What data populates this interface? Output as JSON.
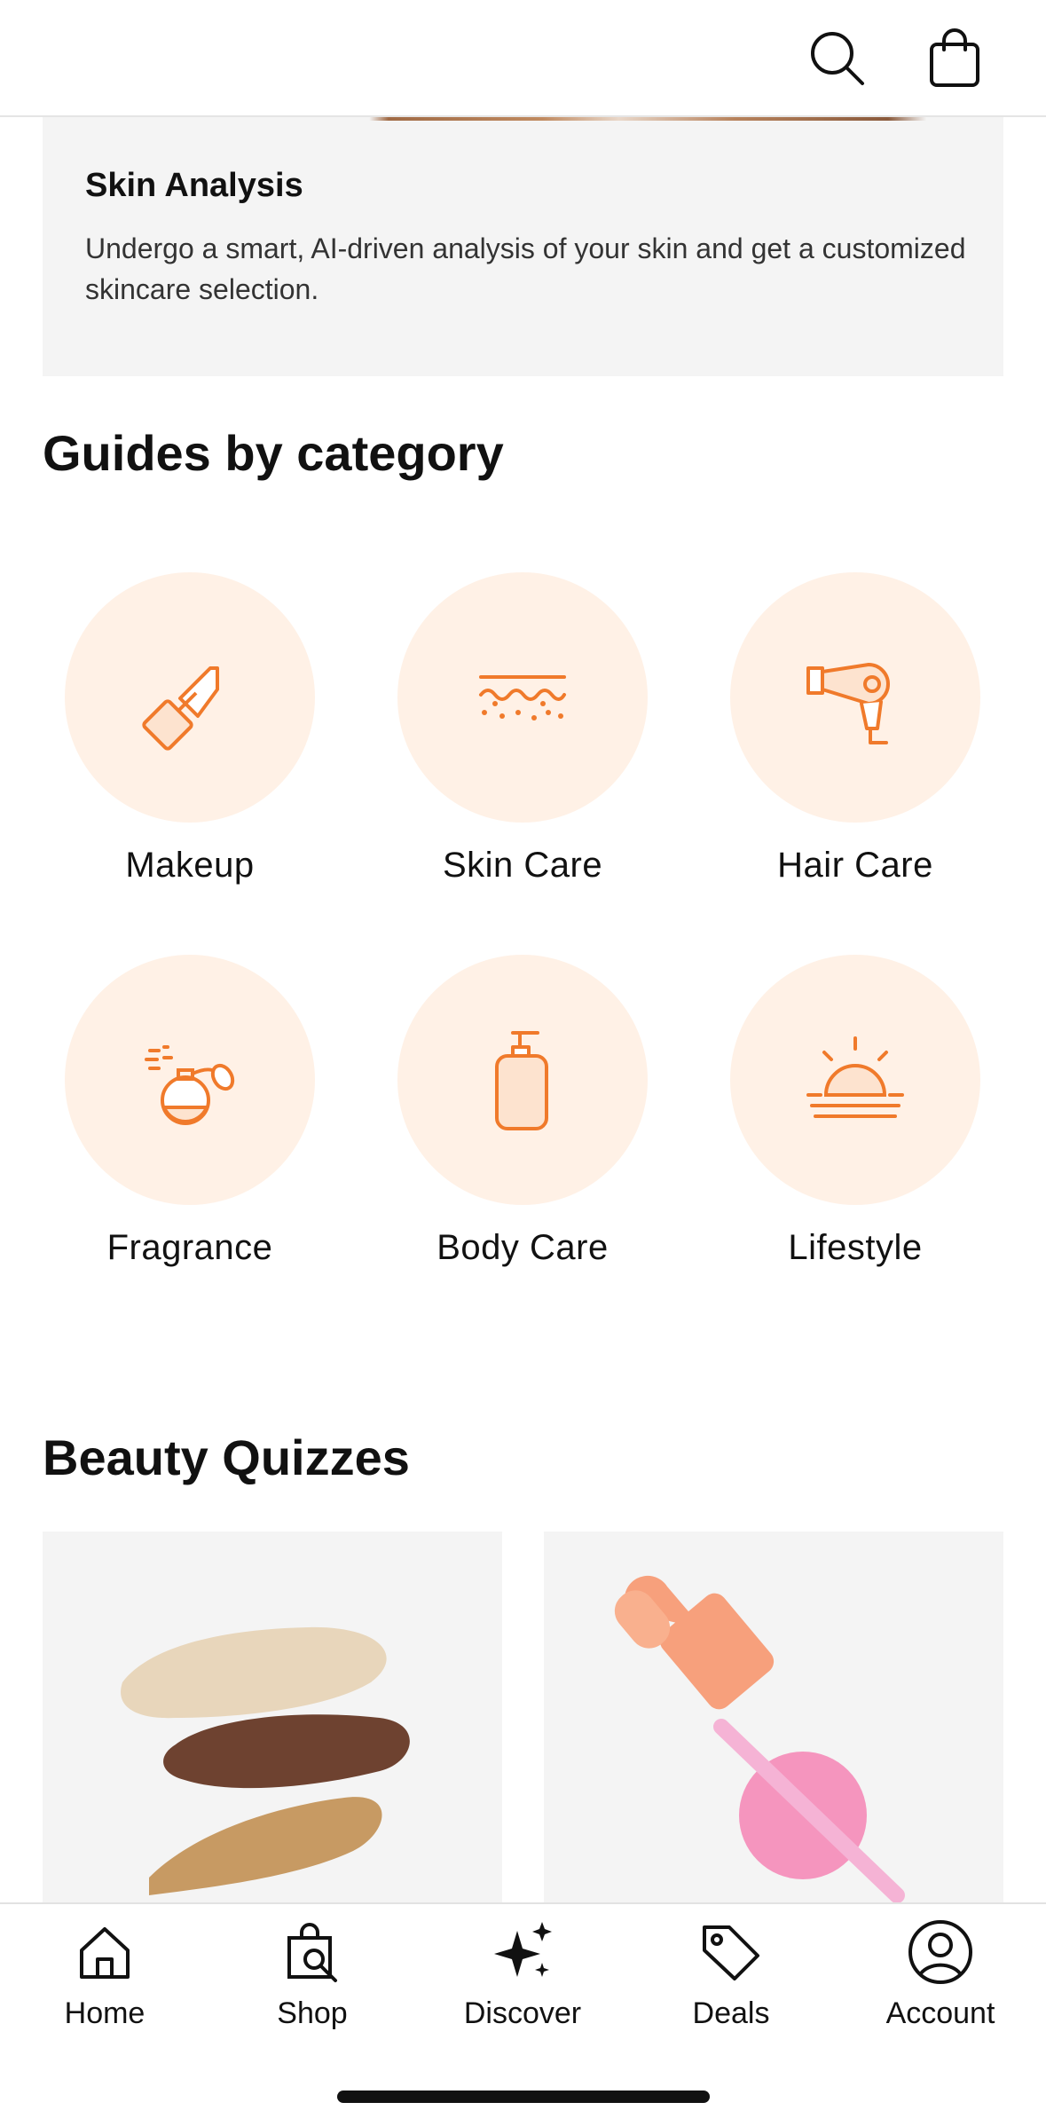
{
  "header": {
    "search_icon": "search-icon",
    "bag_icon": "shopping-bag-icon"
  },
  "skin_analysis": {
    "title": "Skin Analysis",
    "description": "Undergo a smart, AI-driven analysis of your skin and get a customized skincare selection."
  },
  "guides": {
    "title": "Guides by category",
    "categories": [
      {
        "label": "Makeup",
        "icon": "lipstick-icon"
      },
      {
        "label": "Skin Care",
        "icon": "skin-layers-icon"
      },
      {
        "label": "Hair Care",
        "icon": "hair-dryer-icon"
      },
      {
        "label": "Fragrance",
        "icon": "perfume-bottle-icon"
      },
      {
        "label": "Body Care",
        "icon": "pump-bottle-icon"
      },
      {
        "label": "Lifestyle",
        "icon": "sunrise-icon"
      }
    ]
  },
  "quizzes": {
    "title": "Beauty Quizzes",
    "cards": [
      {
        "image": "foundation-swatches-image"
      },
      {
        "image": "serum-dropper-image"
      }
    ]
  },
  "bottom_nav": {
    "items": [
      {
        "label": "Home",
        "icon": "home-icon"
      },
      {
        "label": "Shop",
        "icon": "shop-bag-search-icon"
      },
      {
        "label": "Discover",
        "icon": "sparkles-icon"
      },
      {
        "label": "Deals",
        "icon": "tag-icon"
      },
      {
        "label": "Account",
        "icon": "account-icon"
      }
    ]
  },
  "colors": {
    "accent": "#f07a2b",
    "icon_circle": "#fff1e6",
    "card_bg": "#f4f4f4"
  }
}
